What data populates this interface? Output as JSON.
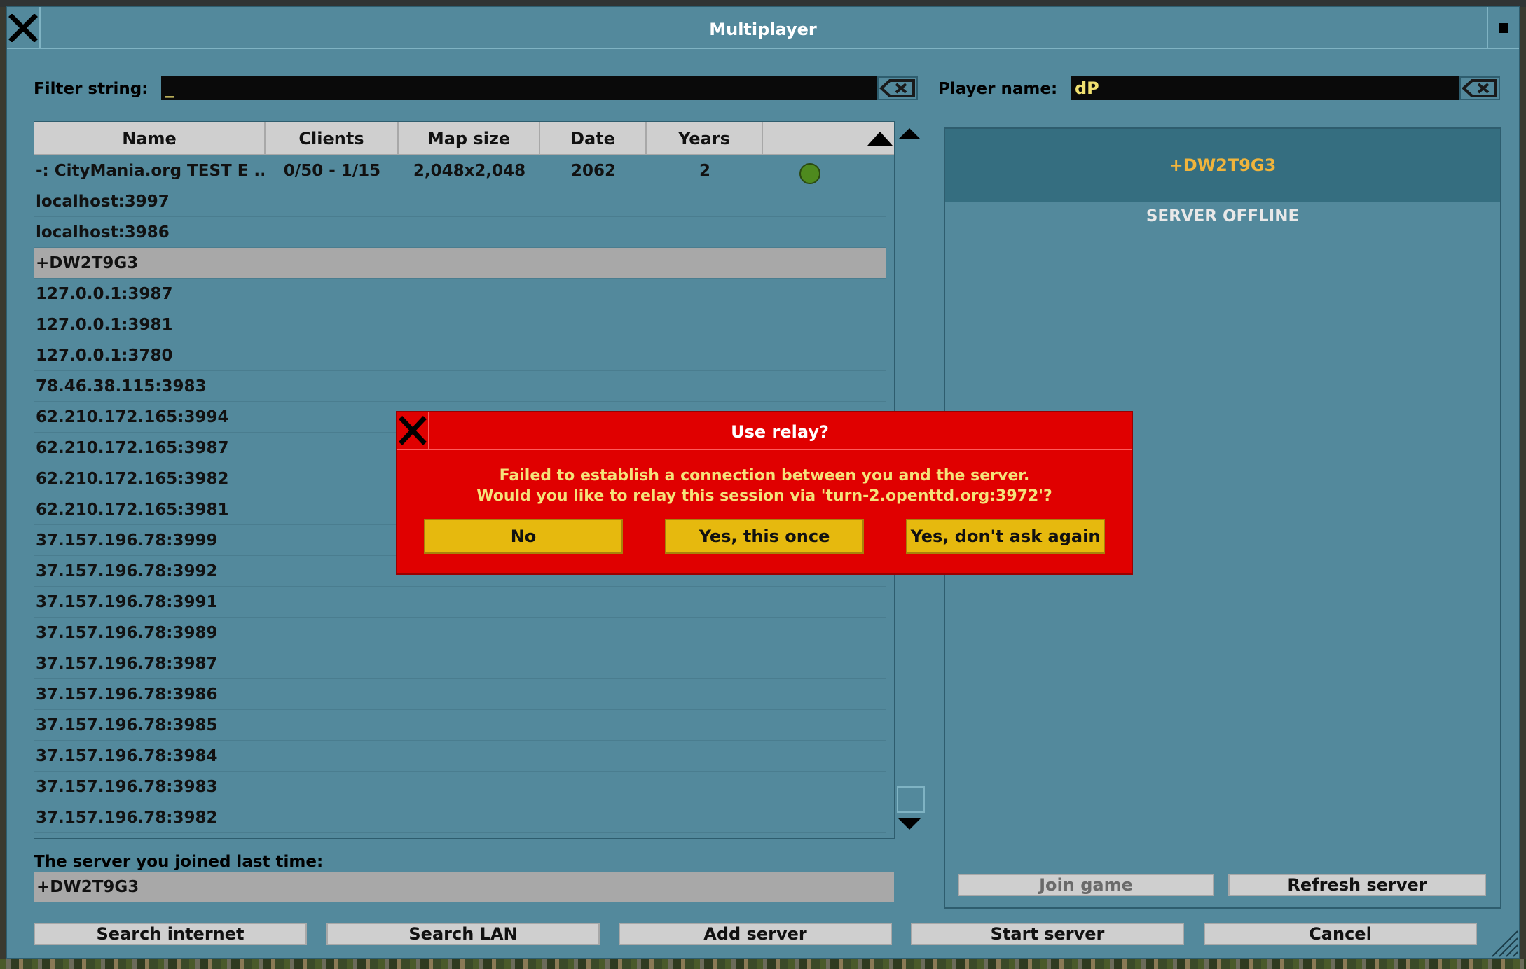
{
  "window": {
    "title": "Multiplayer"
  },
  "filter": {
    "label": "Filter string:",
    "value": "_"
  },
  "player": {
    "label": "Player name:",
    "value": "dP"
  },
  "table": {
    "headers": [
      "Name",
      "Clients",
      "Map size",
      "Date",
      "Years"
    ],
    "rows": [
      {
        "name": "-: CityMania.org TEST E ...",
        "clients": "0/50 - 1/15",
        "map_size": "2,048x2,048",
        "date": "2062",
        "years": "2"
      },
      {
        "name": "localhost:3997"
      },
      {
        "name": "localhost:3986"
      },
      {
        "name": "+DW2T9G3"
      },
      {
        "name": "127.0.0.1:3987"
      },
      {
        "name": "127.0.0.1:3981"
      },
      {
        "name": "127.0.0.1:3780"
      },
      {
        "name": "78.46.38.115:3983"
      },
      {
        "name": "62.210.172.165:3994"
      },
      {
        "name": "62.210.172.165:3987"
      },
      {
        "name": "62.210.172.165:3982"
      },
      {
        "name": "62.210.172.165:3981"
      },
      {
        "name": "37.157.196.78:3999"
      },
      {
        "name": "37.157.196.78:3992"
      },
      {
        "name": "37.157.196.78:3991"
      },
      {
        "name": "37.157.196.78:3989"
      },
      {
        "name": "37.157.196.78:3987"
      },
      {
        "name": "37.157.196.78:3986"
      },
      {
        "name": "37.157.196.78:3985"
      },
      {
        "name": "37.157.196.78:3984"
      },
      {
        "name": "37.157.196.78:3983"
      },
      {
        "name": "37.157.196.78:3982"
      }
    ]
  },
  "last_server": {
    "label": "The server you joined last time:",
    "value": "+DW2T9G3"
  },
  "detail": {
    "server_name": "+DW2T9G3",
    "status": "SERVER OFFLINE",
    "join_label": "Join game",
    "refresh_label": "Refresh server"
  },
  "bottom_buttons": {
    "search_internet": "Search internet",
    "search_lan": "Search LAN",
    "add_server": "Add server",
    "start_server": "Start server",
    "cancel": "Cancel"
  },
  "dialog": {
    "title": "Use relay?",
    "line1": "Failed to establish a connection between you and the server.",
    "line2": "Would you like to relay this session via 'turn-2.openttd.org:3972'?",
    "no": "No",
    "yes_once": "Yes, this once",
    "yes_always": "Yes, don't ask again"
  },
  "colors": {
    "window_bg": "#53899c",
    "dialog_bg": "#e00000",
    "dialog_button": "#e6b90e",
    "field_text": "#f0e070",
    "highlight_text": "#f0b43c",
    "online_dot": "#4e8a1e"
  }
}
